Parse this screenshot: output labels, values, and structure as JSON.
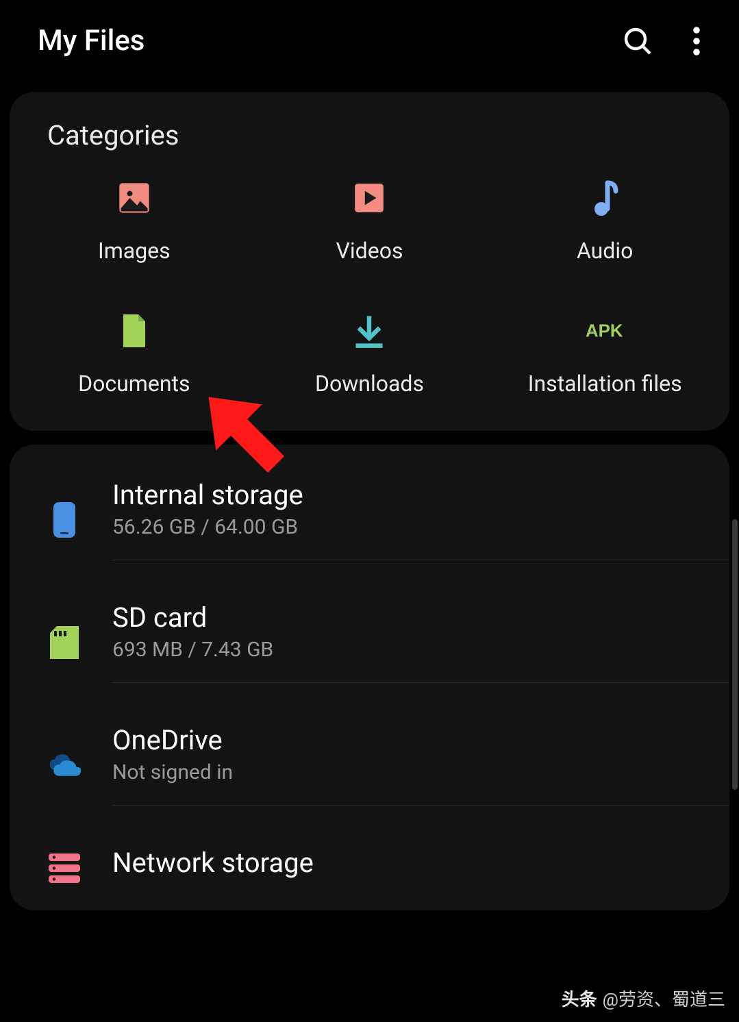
{
  "header": {
    "title": "My Files"
  },
  "categories": {
    "section_title": "Categories",
    "items": [
      {
        "label": "Images"
      },
      {
        "label": "Videos"
      },
      {
        "label": "Audio"
      },
      {
        "label": "Documents"
      },
      {
        "label": "Downloads"
      },
      {
        "label": "Installation files"
      }
    ]
  },
  "storage": {
    "items": [
      {
        "title": "Internal storage",
        "subtitle": "56.26 GB / 64.00 GB"
      },
      {
        "title": "SD card",
        "subtitle": "693 MB / 7.43 GB"
      },
      {
        "title": "OneDrive",
        "subtitle": "Not signed in"
      },
      {
        "title": "Network storage",
        "subtitle": ""
      }
    ]
  },
  "watermark": {
    "brand": "头条",
    "handle": "@劳资、蜀道三"
  }
}
